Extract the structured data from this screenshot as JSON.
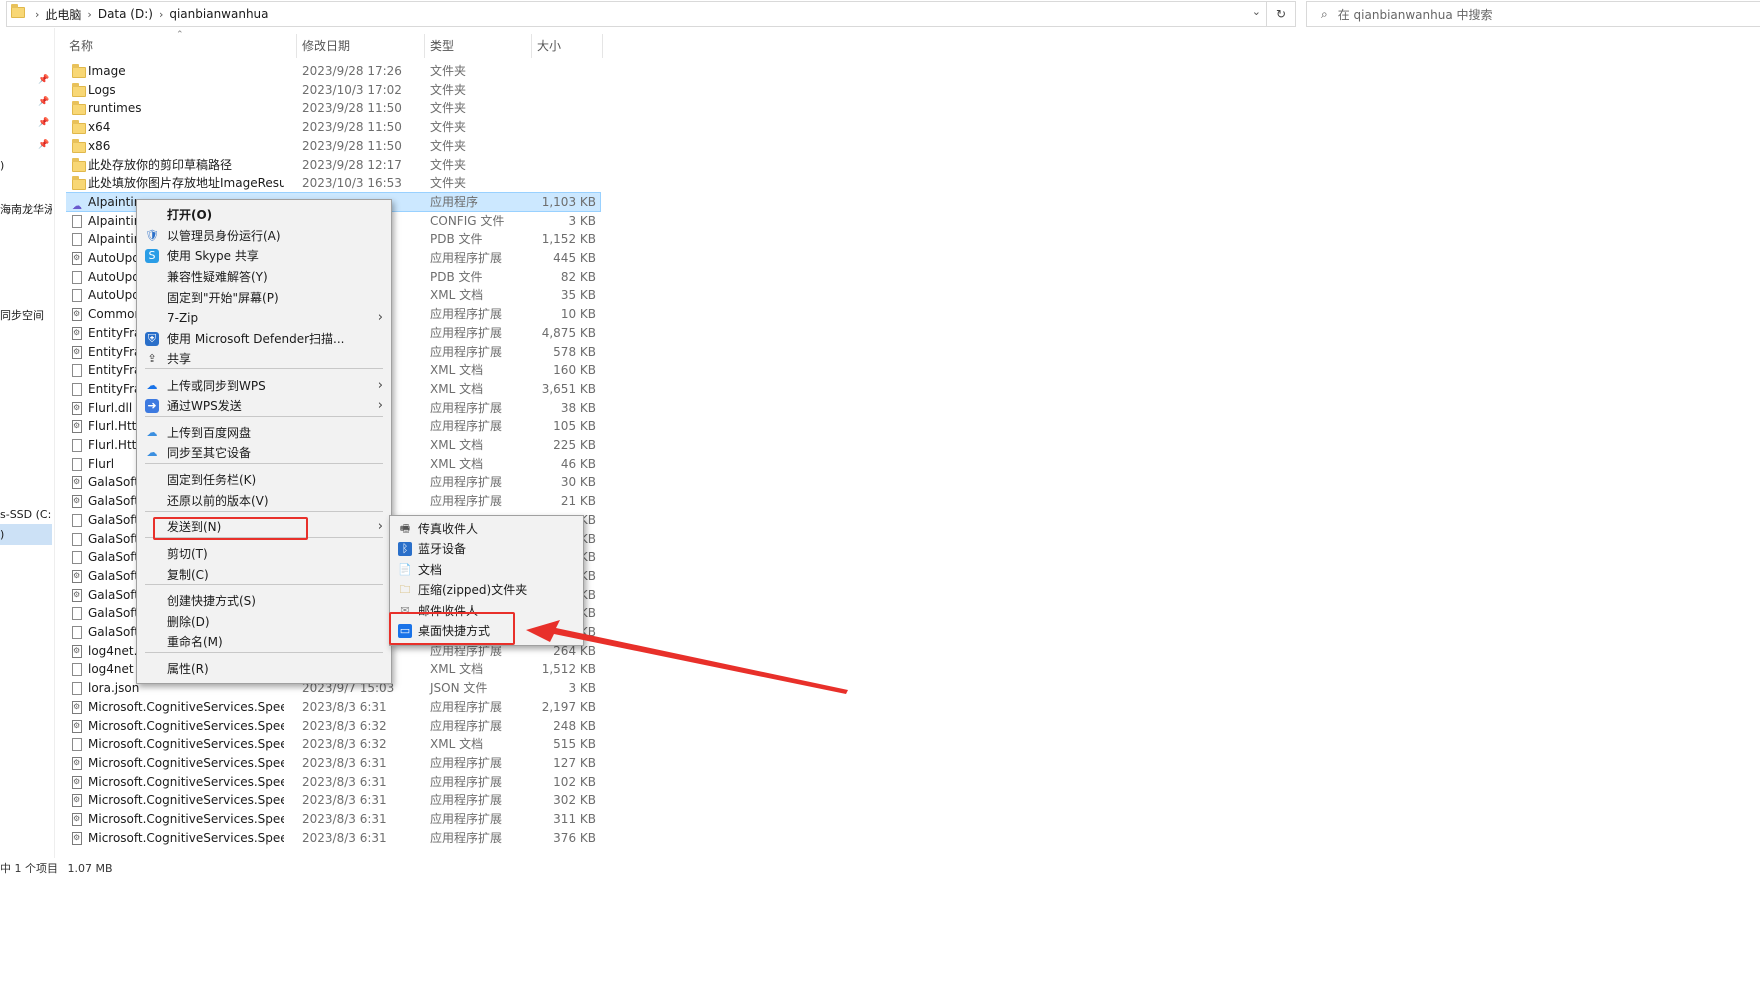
{
  "address_bar": {
    "crumbs": [
      "此电脑",
      "Data (D:)",
      "qianbianwanhua"
    ]
  },
  "search": {
    "placeholder": "在 qianbianwanhua 中搜索"
  },
  "nav_labels": [
    ")",
    "海南龙华泳",
    "同步空间",
    "s-SSD (C:)",
    ")"
  ],
  "columns": {
    "name": "名称",
    "date": "修改日期",
    "type": "类型",
    "size": "大小"
  },
  "files": [
    {
      "icon": "folder-icon",
      "name": "Image",
      "date": "2023/9/28 17:26",
      "type": "文件夹",
      "size": ""
    },
    {
      "icon": "folder-icon",
      "name": "Logs",
      "date": "2023/10/3 17:02",
      "type": "文件夹",
      "size": ""
    },
    {
      "icon": "folder-icon",
      "name": "runtimes",
      "date": "2023/9/28 11:50",
      "type": "文件夹",
      "size": ""
    },
    {
      "icon": "folder-icon",
      "name": "x64",
      "date": "2023/9/28 11:50",
      "type": "文件夹",
      "size": ""
    },
    {
      "icon": "folder-icon",
      "name": "x86",
      "date": "2023/9/28 11:50",
      "type": "文件夹",
      "size": ""
    },
    {
      "icon": "folder-icon",
      "name": "此处存放你的剪印草稿路径",
      "date": "2023/9/28 12:17",
      "type": "文件夹",
      "size": ""
    },
    {
      "icon": "folder-icon",
      "name": "此处填放你图片存放地址ImageResult",
      "date": "2023/10/3 16:53",
      "type": "文件夹",
      "size": ""
    },
    {
      "icon": "app-icon",
      "name": "AIpainting",
      "date": "",
      "type": "应用程序",
      "size": "1,103 KB",
      "selected": true
    },
    {
      "icon": "file-icon",
      "name": "AIpainting",
      "date": "",
      "type": "CONFIG 文件",
      "size": "3 KB"
    },
    {
      "icon": "file-icon",
      "name": "AIpainting",
      "date": "",
      "type": "PDB 文件",
      "size": "1,152 KB"
    },
    {
      "icon": "dll-icon",
      "name": "AutoUpd",
      "date": "",
      "type": "应用程序扩展",
      "size": "445 KB"
    },
    {
      "icon": "file-icon",
      "name": "AutoUpd",
      "date": "",
      "type": "PDB 文件",
      "size": "82 KB"
    },
    {
      "icon": "file-icon",
      "name": "AutoUpd",
      "date": "",
      "type": "XML 文档",
      "size": "35 KB"
    },
    {
      "icon": "dll-icon",
      "name": "Common",
      "date": "",
      "type": "应用程序扩展",
      "size": "10 KB"
    },
    {
      "icon": "dll-icon",
      "name": "EntityFrar",
      "date": "",
      "type": "应用程序扩展",
      "size": "4,875 KB"
    },
    {
      "icon": "dll-icon",
      "name": "EntityFrar",
      "date": "",
      "type": "应用程序扩展",
      "size": "578 KB"
    },
    {
      "icon": "file-icon",
      "name": "EntityFrar",
      "date": "",
      "type": "XML 文档",
      "size": "160 KB"
    },
    {
      "icon": "file-icon",
      "name": "EntityFrar",
      "date": "",
      "type": "XML 文档",
      "size": "3,651 KB"
    },
    {
      "icon": "dll-icon",
      "name": "Flurl.dll",
      "date": "",
      "type": "应用程序扩展",
      "size": "38 KB"
    },
    {
      "icon": "dll-icon",
      "name": "Flurl.Http",
      "date": "",
      "type": "应用程序扩展",
      "size": "105 KB"
    },
    {
      "icon": "file-icon",
      "name": "Flurl.Http",
      "date": "",
      "type": "XML 文档",
      "size": "225 KB"
    },
    {
      "icon": "file-icon",
      "name": "Flurl",
      "date": "",
      "type": "XML 文档",
      "size": "46 KB"
    },
    {
      "icon": "dll-icon",
      "name": "GalaSoft.",
      "date": "",
      "type": "应用程序扩展",
      "size": "30 KB"
    },
    {
      "icon": "dll-icon",
      "name": "GalaSoft.",
      "date": "",
      "type": "应用程序扩展",
      "size": "21 KB"
    },
    {
      "icon": "file-icon",
      "name": "GalaSoft.",
      "date": "",
      "type": "",
      "size": "KB"
    },
    {
      "icon": "file-icon",
      "name": "GalaSoft.",
      "date": "",
      "type": "",
      "size": "KB"
    },
    {
      "icon": "file-icon",
      "name": "GalaSoft.",
      "date": "",
      "type": "",
      "size": "KB"
    },
    {
      "icon": "dll-icon",
      "name": "GalaSoft.",
      "date": "",
      "type": "",
      "size": "KB"
    },
    {
      "icon": "dll-icon",
      "name": "GalaSoft.",
      "date": "",
      "type": "",
      "size": "KB"
    },
    {
      "icon": "file-icon",
      "name": "GalaSoft.",
      "date": "",
      "type": "",
      "size": "KB"
    },
    {
      "icon": "file-icon",
      "name": "GalaSoft.",
      "date": "",
      "type": "",
      "size": "KB"
    },
    {
      "icon": "dll-icon",
      "name": "log4net.d",
      "date": "",
      "type": "应用程序扩展",
      "size": "264 KB"
    },
    {
      "icon": "file-icon",
      "name": "log4net",
      "date": "",
      "type": "XML 文档",
      "size": "1,512 KB"
    },
    {
      "icon": "file-icon",
      "name": "lora.json",
      "date": "2023/9/7 15:03",
      "type": "JSON 文件",
      "size": "3 KB"
    },
    {
      "icon": "dll-icon",
      "name": "Microsoft.CognitiveServices.Speech.c...",
      "date": "2023/8/3 6:31",
      "type": "应用程序扩展",
      "size": "2,197 KB"
    },
    {
      "icon": "dll-icon",
      "name": "Microsoft.CognitiveServices.Speech.c...",
      "date": "2023/8/3 6:32",
      "type": "应用程序扩展",
      "size": "248 KB"
    },
    {
      "icon": "file-icon",
      "name": "Microsoft.CognitiveServices.Speech.c...",
      "date": "2023/8/3 6:32",
      "type": "XML 文档",
      "size": "515 KB"
    },
    {
      "icon": "dll-icon",
      "name": "Microsoft.CognitiveServices.Speech.e...",
      "date": "2023/8/3 6:31",
      "type": "应用程序扩展",
      "size": "127 KB"
    },
    {
      "icon": "dll-icon",
      "name": "Microsoft.CognitiveServices.Speech.e...",
      "date": "2023/8/3 6:31",
      "type": "应用程序扩展",
      "size": "102 KB"
    },
    {
      "icon": "dll-icon",
      "name": "Microsoft.CognitiveServices.Speech.e...",
      "date": "2023/8/3 6:31",
      "type": "应用程序扩展",
      "size": "302 KB"
    },
    {
      "icon": "dll-icon",
      "name": "Microsoft.CognitiveServices.Speech.e...",
      "date": "2023/8/3 6:31",
      "type": "应用程序扩展",
      "size": "311 KB"
    },
    {
      "icon": "dll-icon",
      "name": "Microsoft.CognitiveServices.Speech.e...",
      "date": "2023/8/3 6:31",
      "type": "应用程序扩展",
      "size": "376 KB"
    }
  ],
  "status_bar": {
    "selected": "中 1 个项目",
    "size": "1.07 MB"
  },
  "context_menu": {
    "items": [
      {
        "label": "打开(O)",
        "icon": "none",
        "bold": true
      },
      {
        "label": "以管理员身份运行(A)",
        "icon": "shield-icon"
      },
      {
        "label": "使用 Skype 共享",
        "icon": "skype-icon"
      },
      {
        "label": "兼容性疑难解答(Y)",
        "icon": "none"
      },
      {
        "label": "固定到\"开始\"屏幕(P)",
        "icon": "none"
      },
      {
        "label": "7-Zip",
        "icon": "none",
        "submenu": true
      },
      {
        "label": "使用 Microsoft Defender扫描...",
        "icon": "defender-icon"
      },
      {
        "label": "共享",
        "icon": "share-icon"
      },
      {
        "label": "上传或同步到WPS",
        "icon": "cloud-icon",
        "submenu": true
      },
      {
        "label": "通过WPS发送",
        "icon": "wps-send-icon",
        "submenu": true
      },
      {
        "label": "上传到百度网盘",
        "icon": "baidu-icon"
      },
      {
        "label": "同步至其它设备",
        "icon": "baidu-icon"
      },
      {
        "label": "固定到任务栏(K)",
        "icon": "none"
      },
      {
        "label": "还原以前的版本(V)",
        "icon": "none"
      },
      {
        "label": "发送到(N)",
        "icon": "none",
        "submenu": true,
        "highlighted": true
      },
      {
        "label": "剪切(T)",
        "icon": "none"
      },
      {
        "label": "复制(C)",
        "icon": "none"
      },
      {
        "label": "创建快捷方式(S)",
        "icon": "none"
      },
      {
        "label": "删除(D)",
        "icon": "none"
      },
      {
        "label": "重命名(M)",
        "icon": "none"
      },
      {
        "label": "属性(R)",
        "icon": "none"
      }
    ]
  },
  "send_to_submenu": {
    "items": [
      {
        "label": "传真收件人",
        "icon": "fax-icon"
      },
      {
        "label": "蓝牙设备",
        "icon": "bluetooth-icon"
      },
      {
        "label": "文档",
        "icon": "document-icon"
      },
      {
        "label": "压缩(zipped)文件夹",
        "icon": "zip-folder-icon"
      },
      {
        "label": "邮件收件人",
        "icon": "mail-icon"
      },
      {
        "label": "桌面快捷方式",
        "icon": "desktop-icon",
        "highlighted": true
      }
    ]
  },
  "colors": {
    "annotation": "#e8302a",
    "selection": "#cce8ff"
  }
}
